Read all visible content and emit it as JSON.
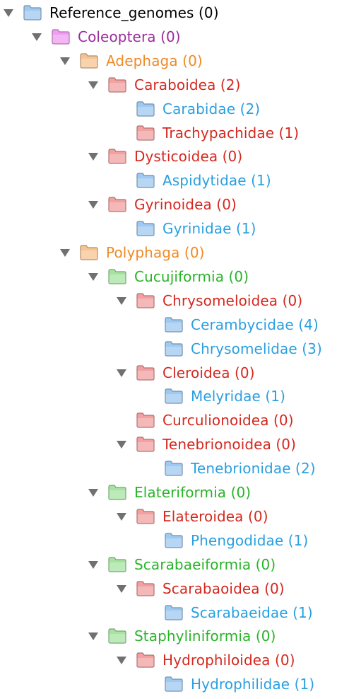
{
  "colors": {
    "black": "#000000",
    "purple": "#9b2d9b",
    "orange": "#f08a24",
    "red": "#d4281f",
    "blue": "#2a9fe0",
    "green": "#28b428",
    "folder_blue": "#9ec9f0",
    "folder_pink": "#ef9df0",
    "folder_orange": "#f6c493",
    "folder_red": "#f2a0a0",
    "folder_green": "#a6e3a1",
    "toggle": "#707070"
  },
  "tree": [
    {
      "label": "Reference_genomes (0)",
      "depth": 0,
      "expanded": true,
      "text_color": "black",
      "folder_color": "blue"
    },
    {
      "label": "Coleoptera (0)",
      "depth": 1,
      "expanded": true,
      "text_color": "purple",
      "folder_color": "pink"
    },
    {
      "label": "Adephaga (0)",
      "depth": 2,
      "expanded": true,
      "text_color": "orange",
      "folder_color": "orange"
    },
    {
      "label": "Caraboidea (2)",
      "depth": 3,
      "expanded": true,
      "text_color": "red",
      "folder_color": "red"
    },
    {
      "label": "Carabidae (2)",
      "depth": 4,
      "expanded": null,
      "text_color": "blue",
      "folder_color": "blue"
    },
    {
      "label": "Trachypachidae (1)",
      "depth": 4,
      "expanded": null,
      "text_color": "red",
      "folder_color": "red"
    },
    {
      "label": "Dysticoidea (0)",
      "depth": 3,
      "expanded": true,
      "text_color": "red",
      "folder_color": "red"
    },
    {
      "label": "Aspidytidae (1)",
      "depth": 4,
      "expanded": null,
      "text_color": "blue",
      "folder_color": "blue"
    },
    {
      "label": "Gyrinoidea (0)",
      "depth": 3,
      "expanded": true,
      "text_color": "red",
      "folder_color": "red"
    },
    {
      "label": "Gyrinidae (1)",
      "depth": 4,
      "expanded": null,
      "text_color": "blue",
      "folder_color": "blue"
    },
    {
      "label": "Polyphaga (0)",
      "depth": 2,
      "expanded": true,
      "text_color": "orange",
      "folder_color": "orange"
    },
    {
      "label": "Cucujiformia (0)",
      "depth": 3,
      "expanded": true,
      "text_color": "green",
      "folder_color": "green"
    },
    {
      "label": "Chrysomeloidea (0)",
      "depth": 4,
      "expanded": true,
      "text_color": "red",
      "folder_color": "red"
    },
    {
      "label": "Cerambycidae (4)",
      "depth": 5,
      "expanded": null,
      "text_color": "blue",
      "folder_color": "blue"
    },
    {
      "label": "Chrysomelidae (3)",
      "depth": 5,
      "expanded": null,
      "text_color": "blue",
      "folder_color": "blue"
    },
    {
      "label": "Cleroidea (0)",
      "depth": 4,
      "expanded": true,
      "text_color": "red",
      "folder_color": "red"
    },
    {
      "label": "Melyridae (1)",
      "depth": 5,
      "expanded": null,
      "text_color": "blue",
      "folder_color": "blue"
    },
    {
      "label": "Curculionoidea (0)",
      "depth": 4,
      "expanded": null,
      "text_color": "red",
      "folder_color": "red"
    },
    {
      "label": "Tenebrionoidea (0)",
      "depth": 4,
      "expanded": true,
      "text_color": "red",
      "folder_color": "red"
    },
    {
      "label": "Tenebrionidae (2)",
      "depth": 5,
      "expanded": null,
      "text_color": "blue",
      "folder_color": "blue"
    },
    {
      "label": "Elateriformia (0)",
      "depth": 3,
      "expanded": true,
      "text_color": "green",
      "folder_color": "green"
    },
    {
      "label": "Elateroidea (0)",
      "depth": 4,
      "expanded": true,
      "text_color": "red",
      "folder_color": "red"
    },
    {
      "label": "Phengodidae (1)",
      "depth": 5,
      "expanded": null,
      "text_color": "blue",
      "folder_color": "blue"
    },
    {
      "label": "Scarabaeiformia (0)",
      "depth": 3,
      "expanded": true,
      "text_color": "green",
      "folder_color": "green"
    },
    {
      "label": "Scarabaoidea (0)",
      "depth": 4,
      "expanded": true,
      "text_color": "red",
      "folder_color": "red"
    },
    {
      "label": "Scarabaeidae (1)",
      "depth": 5,
      "expanded": null,
      "text_color": "blue",
      "folder_color": "blue"
    },
    {
      "label": "Staphyliniformia (0)",
      "depth": 3,
      "expanded": true,
      "text_color": "green",
      "folder_color": "green"
    },
    {
      "label": "Hydrophiloidea (0)",
      "depth": 4,
      "expanded": true,
      "text_color": "red",
      "folder_color": "red"
    },
    {
      "label": "Hydrophilidae (1)",
      "depth": 5,
      "expanded": null,
      "text_color": "blue",
      "folder_color": "blue"
    }
  ]
}
